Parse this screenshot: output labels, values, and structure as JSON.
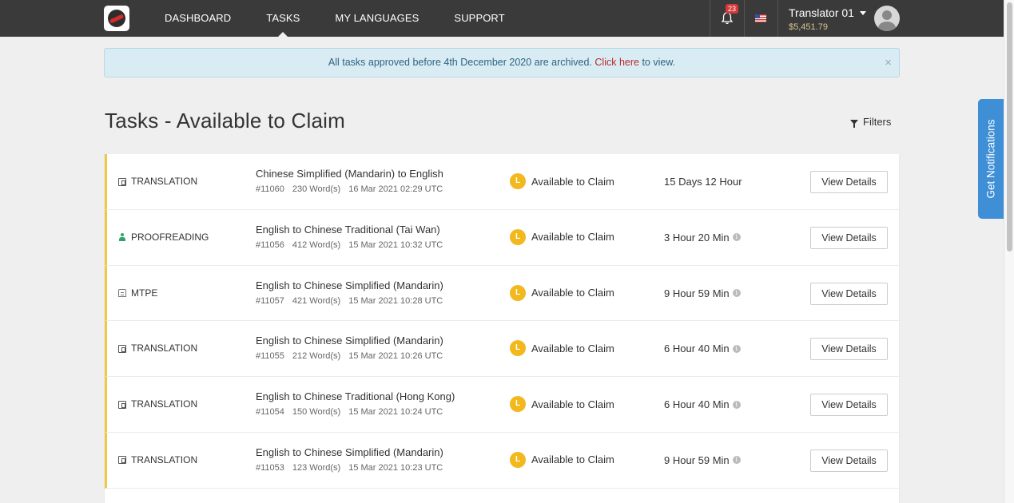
{
  "nav": {
    "items": [
      {
        "label": "DASHBOARD"
      },
      {
        "label": "TASKS"
      },
      {
        "label": "MY LANGUAGES"
      },
      {
        "label": "SUPPORT"
      }
    ],
    "active": "TASKS",
    "notification_count": "23",
    "user": {
      "name": "Translator 01",
      "balance": "$5,451.79"
    }
  },
  "alert": {
    "text_before": "All tasks approved before 4th December 2020 are archived. ",
    "link": "Click here",
    "text_after": " to view.",
    "close": "×"
  },
  "page": {
    "title": "Tasks -  Available to Claim",
    "filters_label": "Filters"
  },
  "tasks": [
    {
      "type": "TRANSLATION",
      "icon": "translation-icon",
      "title": "Chinese Simplified (Mandarin) to English",
      "id": "#11060",
      "words": "230 Word(s)",
      "date": "16 Mar 2021 02:29 UTC",
      "status": "Available to Claim",
      "status_badge": "L",
      "time": "15 Days 12 Hour",
      "info": false,
      "button": "View Details"
    },
    {
      "type": "PROOFREADING",
      "icon": "proofreading-icon",
      "title": "English to Chinese Traditional (Tai Wan)",
      "id": "#11056",
      "words": "412 Word(s)",
      "date": "15 Mar 2021 10:32 UTC",
      "status": "Available to Claim",
      "status_badge": "L",
      "time": "3 Hour 20 Min",
      "info": true,
      "button": "View Details"
    },
    {
      "type": "MTPE",
      "icon": "mtpe-icon",
      "title": "English to Chinese Simplified (Mandarin)",
      "id": "#11057",
      "words": "421 Word(s)",
      "date": "15 Mar 2021 10:28 UTC",
      "status": "Available to Claim",
      "status_badge": "L",
      "time": "9 Hour 59 Min",
      "info": true,
      "button": "View Details"
    },
    {
      "type": "TRANSLATION",
      "icon": "translation-icon",
      "title": "English to Chinese Simplified (Mandarin)",
      "id": "#11055",
      "words": "212 Word(s)",
      "date": "15 Mar 2021 10:26 UTC",
      "status": "Available to Claim",
      "status_badge": "L",
      "time": "6 Hour 40 Min",
      "info": true,
      "button": "View Details"
    },
    {
      "type": "TRANSLATION",
      "icon": "translation-icon",
      "title": "English to Chinese Traditional (Hong Kong)",
      "id": "#11054",
      "words": "150 Word(s)",
      "date": "15 Mar 2021 10:24 UTC",
      "status": "Available to Claim",
      "status_badge": "L",
      "time": "6 Hour 40 Min",
      "info": true,
      "button": "View Details"
    },
    {
      "type": "TRANSLATION",
      "icon": "translation-icon",
      "title": "English to Chinese Simplified (Mandarin)",
      "id": "#11053",
      "words": "123 Word(s)",
      "date": "15 Mar 2021 10:23 UTC",
      "status": "Available to Claim",
      "status_badge": "L",
      "time": "9 Hour 59 Min",
      "info": true,
      "button": "View Details"
    }
  ],
  "side_tab": {
    "label": "Get Notifications"
  },
  "colors": {
    "topbar": "#3a3a3a",
    "accent_border": "#f2c744",
    "status_badge": "#f2b81e",
    "link": "#b72b2b",
    "notify_tab": "#3f8fd6"
  }
}
